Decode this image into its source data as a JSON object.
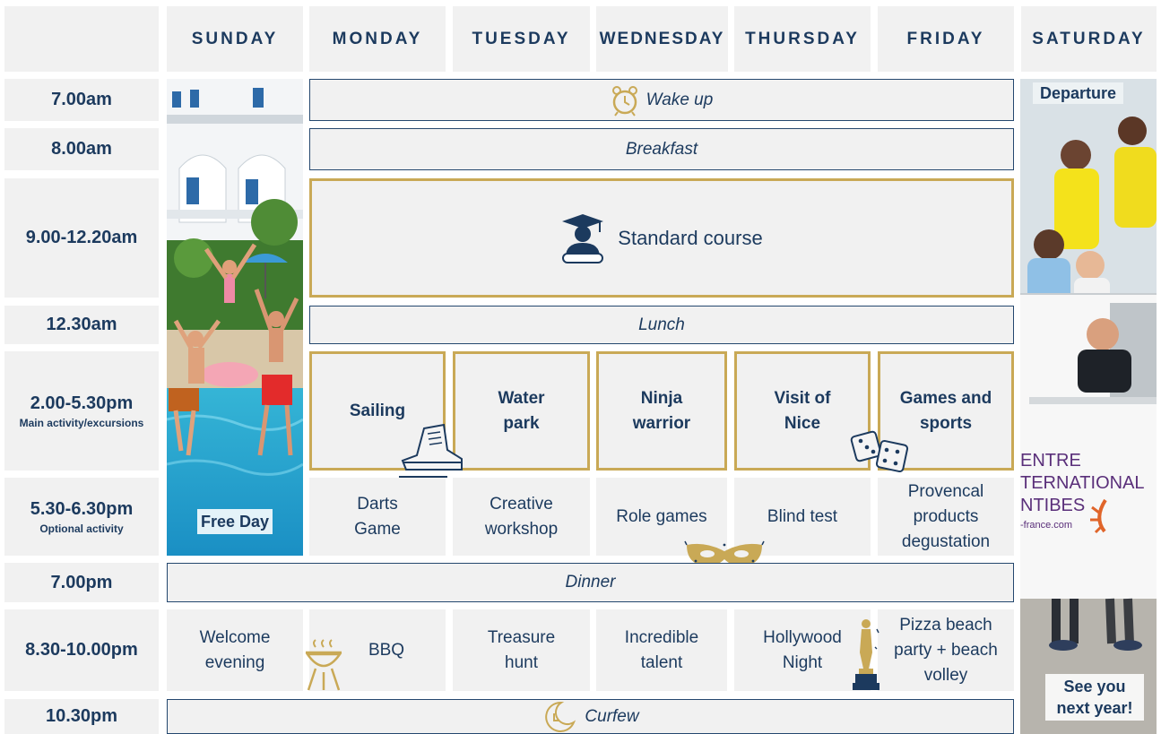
{
  "days": [
    "SUNDAY",
    "MONDAY",
    "TUESDAY",
    "WEDNESDAY",
    "THURSDAY",
    "FRIDAY",
    "SATURDAY"
  ],
  "times": [
    {
      "label": "7.00am",
      "sub": ""
    },
    {
      "label": "8.00am",
      "sub": ""
    },
    {
      "label": "9.00-12.20am",
      "sub": ""
    },
    {
      "label": "12.30am",
      "sub": ""
    },
    {
      "label": "2.00-5.30pm",
      "sub": "Main activity/excursions"
    },
    {
      "label": "5.30-6.30pm",
      "sub": "Optional activity"
    },
    {
      "label": "7.00pm",
      "sub": ""
    },
    {
      "label": "8.30-10.00pm",
      "sub": ""
    },
    {
      "label": "10.30pm",
      "sub": ""
    }
  ],
  "common": {
    "wake_up": "Wake up",
    "breakfast": "Breakfast",
    "course": "Standard course",
    "lunch": "Lunch",
    "dinner": "Dinner",
    "curfew": "Curfew"
  },
  "main_activities": [
    "Sailing",
    "Water\npark",
    "Ninja\nwarrior",
    "Visit of\nNice",
    "Games and\nsports"
  ],
  "optional_activities": [
    "Darts\nGame",
    "Creative\nworkshop",
    "Role games",
    "Blind test",
    "Provencal\nproducts\ndegustation"
  ],
  "evening_activities": [
    "Welcome\nevening",
    "BBQ",
    "Treasure\nhunt",
    "Incredible\ntalent",
    "Hollywood\nNight",
    "Pizza beach\nparty + beach\nvolley"
  ],
  "sunday_label": "Free Day",
  "saturday": {
    "departure": "Departure",
    "farewell": "See you\nnext year!",
    "van_text": [
      "ENTRE",
      "TERNATIONAL",
      "NTIBES",
      "-france.com"
    ]
  },
  "icons": [
    "alarm-clock-icon",
    "graduate-icon",
    "hiking-boot-icon",
    "dice-icon",
    "carnival-mask-icon",
    "bbq-grill-icon",
    "oscar-statue-icon",
    "crescent-moon-icon"
  ],
  "colors": {
    "navy": "#1c3a5e",
    "gold": "#c9a956",
    "cell": "#f1f1f1"
  }
}
